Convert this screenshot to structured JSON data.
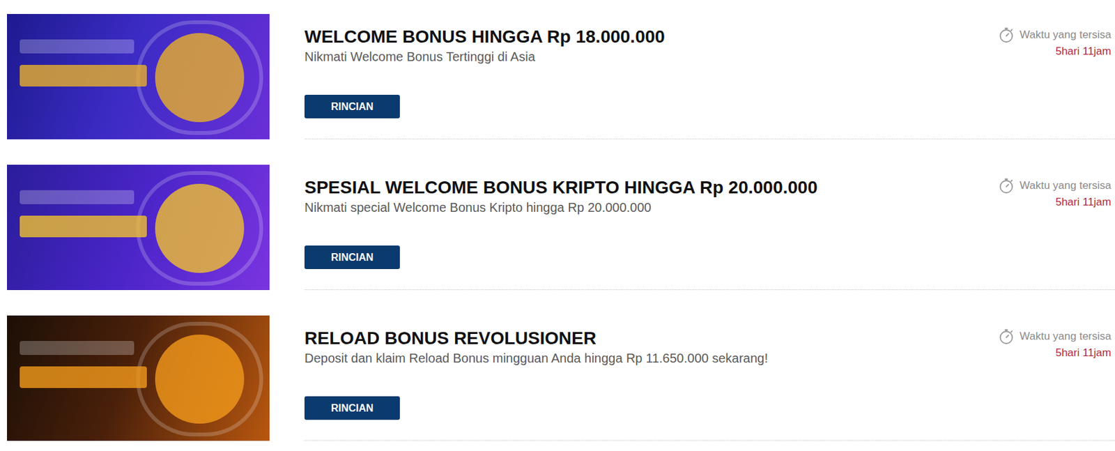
{
  "promotions": [
    {
      "title": "WELCOME BONUS HINGGA Rp 18.000.000",
      "subtitle": "Nikmati Welcome Bonus Tertinggi di Asia",
      "button": "RINCIAN",
      "time_label": "Waktu yang tersisa",
      "time_remaining": "5hari 11jam"
    },
    {
      "title": "SPESIAL WELCOME BONUS KRIPTO HINGGA Rp 20.000.000",
      "subtitle": "Nikmati special Welcome Bonus Kripto hingga Rp 20.000.000",
      "button": "RINCIAN",
      "time_label": "Waktu yang tersisa",
      "time_remaining": "5hari 11jam"
    },
    {
      "title": "RELOAD BONUS REVOLUSIONER",
      "subtitle": "Deposit dan klaim Reload Bonus mingguan Anda hingga Rp 11.650.000 sekarang!",
      "button": "RINCIAN",
      "time_label": "Waktu yang tersisa",
      "time_remaining": "5hari 11jam"
    }
  ]
}
